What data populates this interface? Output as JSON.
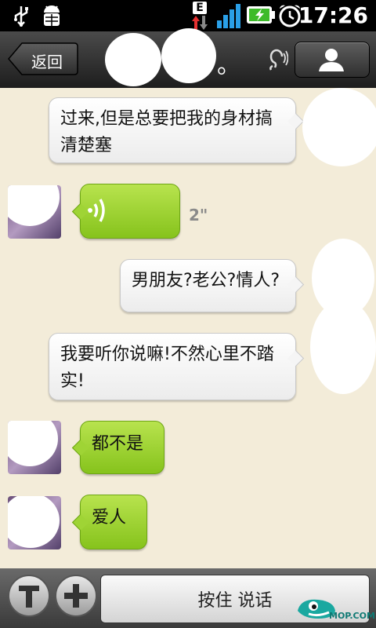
{
  "statusbar": {
    "time": "17:26",
    "network_badge": "E",
    "icons": [
      "usb-icon",
      "android-debug-icon",
      "network-data-icon",
      "signal-icon",
      "battery-charging-icon",
      "alarm-icon"
    ]
  },
  "titlebar": {
    "back_label": "返回",
    "title_suffix": "。",
    "icons": [
      "ear-icon",
      "profile-icon"
    ]
  },
  "messages": [
    {
      "side": "right",
      "type": "text",
      "text_lines": [
        "过来,但是总要把我的身材搞",
        "清楚塞"
      ]
    },
    {
      "side": "left",
      "type": "voice",
      "duration": "2\""
    },
    {
      "side": "right",
      "type": "text",
      "text_lines": [
        "男朋友?老公?情人?"
      ]
    },
    {
      "side": "right",
      "type": "text",
      "text_lines": [
        "我要听你说嘛!不然心里不踏",
        "实!"
      ]
    },
    {
      "side": "left",
      "type": "text",
      "text_lines": [
        "都不是"
      ]
    },
    {
      "side": "left",
      "type": "text",
      "text_lines": [
        "爱人"
      ]
    }
  ],
  "bottombar": {
    "talk_label": "按住 说话",
    "icons": [
      "text-mode-icon",
      "plus-icon"
    ]
  },
  "watermark": {
    "text": "MOP.COM"
  },
  "colors": {
    "chat_bg": "#f3ecd9",
    "left_bubble": "#9fd435",
    "right_bubble": "#f5f5f5",
    "titlebar": "#2b2b2b"
  }
}
